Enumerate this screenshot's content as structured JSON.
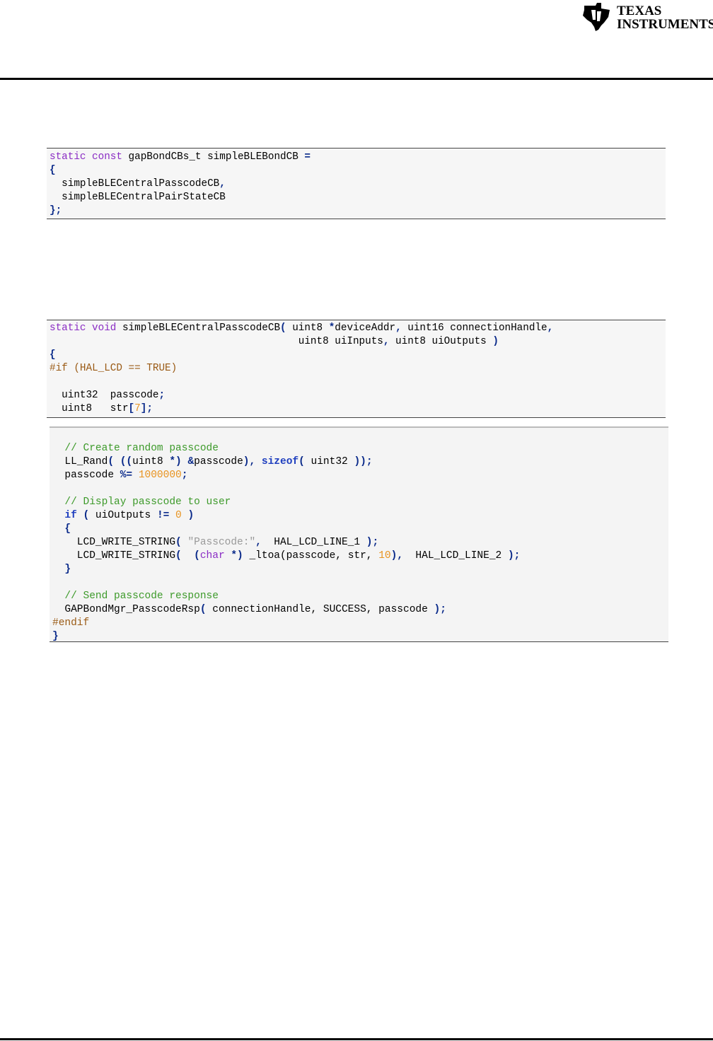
{
  "header": {
    "logo_line1": "Texas",
    "logo_line2": "Instruments"
  },
  "code_block_1": {
    "lines": [
      [
        {
          "t": "static const",
          "c": "kw"
        },
        {
          "t": " gapBondCBs_t simpleBLEBondCB ",
          "c": ""
        },
        {
          "t": "=",
          "c": "pun"
        }
      ],
      [
        {
          "t": "{",
          "c": "pun"
        }
      ],
      [
        {
          "t": "  simpleBLECentralPasscodeCB",
          "c": ""
        },
        {
          "t": ",",
          "c": "pun"
        }
      ],
      [
        {
          "t": "  simpleBLECentralPairStateCB",
          "c": ""
        }
      ],
      [
        {
          "t": "};",
          "c": "pun"
        }
      ]
    ]
  },
  "code_block_2": {
    "lines": [
      [
        {
          "t": "static void",
          "c": "kw"
        },
        {
          "t": " simpleBLECentralPasscodeCB",
          "c": ""
        },
        {
          "t": "(",
          "c": "pun"
        },
        {
          "t": " uint8 ",
          "c": ""
        },
        {
          "t": "*",
          "c": "pun"
        },
        {
          "t": "deviceAddr",
          "c": ""
        },
        {
          "t": ",",
          "c": "pun"
        },
        {
          "t": " uint16 connectionHandle",
          "c": ""
        },
        {
          "t": ",",
          "c": "pun"
        }
      ],
      [
        {
          "t": "                                         uint8 uiInputs",
          "c": ""
        },
        {
          "t": ",",
          "c": "pun"
        },
        {
          "t": " uint8 uiOutputs ",
          "c": ""
        },
        {
          "t": ")",
          "c": "pun"
        }
      ],
      [
        {
          "t": "{",
          "c": "pun"
        }
      ],
      [
        {
          "t": "#if",
          "c": "pre"
        },
        {
          "t": " (HAL_LCD == TRUE)",
          "c": "pre"
        }
      ],
      [
        {
          "t": "",
          "c": ""
        }
      ],
      [
        {
          "t": "  uint32  passcode",
          "c": ""
        },
        {
          "t": ";",
          "c": "pun"
        }
      ],
      [
        {
          "t": "  uint8   str",
          "c": ""
        },
        {
          "t": "[",
          "c": "pun"
        },
        {
          "t": "7",
          "c": "num"
        },
        {
          "t": "];",
          "c": "pun"
        }
      ]
    ]
  },
  "code_block_3": {
    "lines": [
      [
        {
          "t": "  // Create random passcode",
          "c": "cmt"
        }
      ],
      [
        {
          "t": "  LL_Rand",
          "c": ""
        },
        {
          "t": "(",
          "c": "pun"
        },
        {
          "t": " ",
          "c": ""
        },
        {
          "t": "((",
          "c": "pun"
        },
        {
          "t": "uint8 ",
          "c": ""
        },
        {
          "t": "*)",
          "c": "pun"
        },
        {
          "t": " ",
          "c": ""
        },
        {
          "t": "&",
          "c": "pun"
        },
        {
          "t": "passcode",
          "c": ""
        },
        {
          "t": "),",
          "c": "pun"
        },
        {
          "t": " ",
          "c": ""
        },
        {
          "t": "sizeof",
          "c": "kwb"
        },
        {
          "t": "(",
          "c": "pun"
        },
        {
          "t": " uint32 ",
          "c": ""
        },
        {
          "t": "));",
          "c": "pun"
        }
      ],
      [
        {
          "t": "  passcode ",
          "c": ""
        },
        {
          "t": "%=",
          "c": "pun"
        },
        {
          "t": " ",
          "c": ""
        },
        {
          "t": "1000000",
          "c": "num"
        },
        {
          "t": ";",
          "c": "pun"
        }
      ],
      [
        {
          "t": "",
          "c": ""
        }
      ],
      [
        {
          "t": "  // Display passcode to user",
          "c": "cmt"
        }
      ],
      [
        {
          "t": "  ",
          "c": ""
        },
        {
          "t": "if",
          "c": "kwb"
        },
        {
          "t": " ",
          "c": ""
        },
        {
          "t": "(",
          "c": "pun"
        },
        {
          "t": " uiOutputs ",
          "c": ""
        },
        {
          "t": "!=",
          "c": "pun"
        },
        {
          "t": " ",
          "c": ""
        },
        {
          "t": "0",
          "c": "num"
        },
        {
          "t": " ",
          "c": ""
        },
        {
          "t": ")",
          "c": "pun"
        }
      ],
      [
        {
          "t": "  ",
          "c": ""
        },
        {
          "t": "{",
          "c": "pun"
        }
      ],
      [
        {
          "t": "    LCD_WRITE_STRING",
          "c": ""
        },
        {
          "t": "(",
          "c": "pun"
        },
        {
          "t": " ",
          "c": ""
        },
        {
          "t": "\"Passcode:\"",
          "c": "str"
        },
        {
          "t": ",",
          "c": "pun"
        },
        {
          "t": "  HAL_LCD_LINE_1 ",
          "c": ""
        },
        {
          "t": ");",
          "c": "pun"
        }
      ],
      [
        {
          "t": "    LCD_WRITE_STRING",
          "c": ""
        },
        {
          "t": "(",
          "c": "pun"
        },
        {
          "t": "  ",
          "c": ""
        },
        {
          "t": "(",
          "c": "pun"
        },
        {
          "t": "char",
          "c": "kw"
        },
        {
          "t": " ",
          "c": ""
        },
        {
          "t": "*)",
          "c": "pun"
        },
        {
          "t": " _ltoa(passcode, str, ",
          "c": ""
        },
        {
          "t": "10",
          "c": "num"
        },
        {
          "t": "),",
          "c": "pun"
        },
        {
          "t": "  HAL_LCD_LINE_2 ",
          "c": ""
        },
        {
          "t": ");",
          "c": "pun"
        }
      ],
      [
        {
          "t": "  ",
          "c": ""
        },
        {
          "t": "}",
          "c": "pun"
        }
      ],
      [
        {
          "t": "",
          "c": ""
        }
      ],
      [
        {
          "t": "  // Send passcode response",
          "c": "cmt"
        }
      ],
      [
        {
          "t": "  GAPBondMgr_PasscodeRsp",
          "c": ""
        },
        {
          "t": "(",
          "c": "pun"
        },
        {
          "t": " connectionHandle, SUCCESS, passcode ",
          "c": ""
        },
        {
          "t": ");",
          "c": "pun"
        }
      ],
      [
        {
          "t": "#endif",
          "c": "pre"
        }
      ],
      [
        {
          "t": "}",
          "c": "pun"
        }
      ]
    ]
  }
}
